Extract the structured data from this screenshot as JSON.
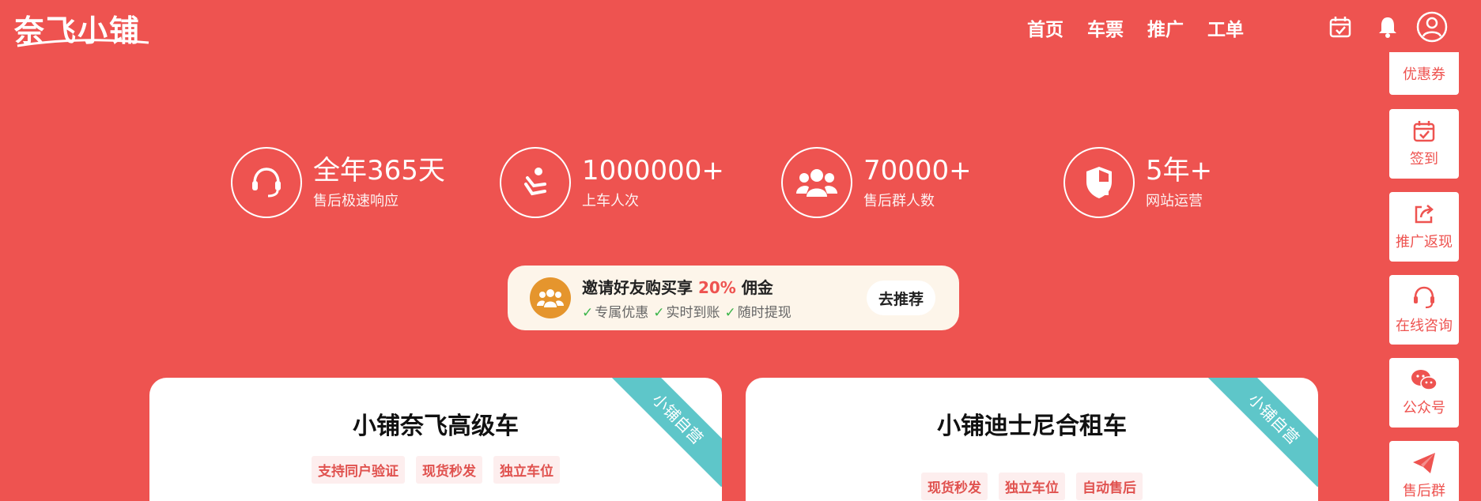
{
  "logo": {
    "text": "奈飞小铺"
  },
  "nav": {
    "items": [
      {
        "label": "首页"
      },
      {
        "label": "车票"
      },
      {
        "label": "推广"
      },
      {
        "label": "工单"
      }
    ]
  },
  "header_icons": [
    "calendar-check-icon",
    "bell-icon",
    "user-icon"
  ],
  "stats": [
    {
      "value": "全年365天",
      "label": "售后极速响应",
      "icon": "headset-icon"
    },
    {
      "value": "1000000+",
      "label": "上车人次",
      "icon": "seat-icon"
    },
    {
      "value": "70000+",
      "label": "售后群人数",
      "icon": "users-icon"
    },
    {
      "value": "5年+",
      "label": "网站运营",
      "icon": "shield-icon"
    }
  ],
  "promo": {
    "title_prefix": "邀请好友购买享",
    "title_pct": "20%",
    "title_suffix": "佣金",
    "features": [
      "专属优惠",
      "实时到账",
      "随时提现"
    ],
    "button": "去推荐"
  },
  "cards": [
    {
      "title": "小铺奈飞高级车",
      "ribbon": "小铺自营",
      "tags": [
        "支持同户验证",
        "现货秒发",
        "独立车位"
      ]
    },
    {
      "title": "小铺迪士尼合租车",
      "ribbon": "小铺自营",
      "tags": [
        "现货秒发",
        "独立车位",
        "自动售后"
      ]
    }
  ],
  "sidebar": {
    "items": [
      {
        "label": "优惠券",
        "icon": "coupon-icon"
      },
      {
        "label": "签到",
        "icon": "calendar-check-icon"
      },
      {
        "label": "推广返现",
        "icon": "share-icon"
      },
      {
        "label": "在线咨询",
        "icon": "headset-icon"
      },
      {
        "label": "公众号",
        "icon": "wechat-icon"
      },
      {
        "label": "售后群",
        "icon": "paper-plane-icon"
      }
    ]
  },
  "colors": {
    "primary": "#ee5350",
    "ribbon": "#5ec6c9",
    "promo_bg": "#fdf5ea",
    "check": "#3bb54a"
  }
}
